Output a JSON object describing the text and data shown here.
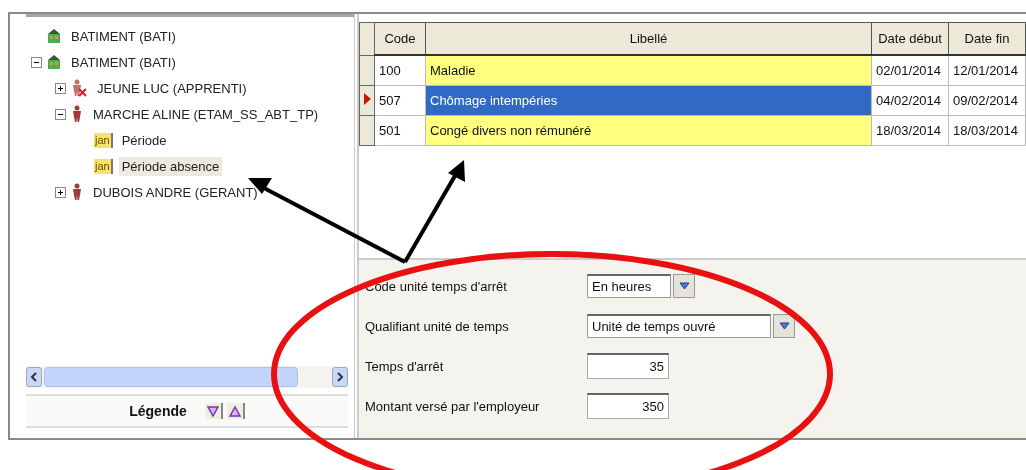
{
  "tree": [
    {
      "label": "BATIMENT (BATI)",
      "kind": "building",
      "selected": false
    },
    {
      "label": "BATIMENT (BATI)",
      "kind": "building",
      "selected": false,
      "expanded": true,
      "children": [
        {
          "label": "JEUNE LUC (APPRENTI)",
          "kind": "person_excluded",
          "selected": false,
          "expanded": false
        },
        {
          "label": "MARCHE ALINE (ETAM_SS_ABT_TP)",
          "kind": "person",
          "selected": false,
          "expanded": true,
          "children": [
            {
              "label": "Période",
              "kind": "calendar",
              "icon_label": "jan",
              "selected": false
            },
            {
              "label": "Période absence",
              "kind": "calendar",
              "icon_label": "jan",
              "selected": true
            }
          ]
        },
        {
          "label": "DUBOIS ANDRE (GERANT)",
          "kind": "person",
          "selected": false,
          "expanded": false
        }
      ]
    }
  ],
  "legend": {
    "label": "Légende"
  },
  "table": {
    "columns": [
      "Code",
      "Libellé",
      "Date début",
      "Date fin"
    ],
    "rows": [
      {
        "cells": [
          "100",
          "Maladie",
          "02/01/2014",
          "12/01/2014"
        ],
        "selected": false
      },
      {
        "cells": [
          "507",
          "Chômage intempéries",
          "04/02/2014",
          "09/02/2014"
        ],
        "selected": true
      },
      {
        "cells": [
          "501",
          "Congé divers non rémunéré",
          "18/03/2014",
          "18/03/2014"
        ],
        "selected": false
      }
    ]
  },
  "form": [
    {
      "label": "Code unité temps d'arrêt",
      "kind": "select",
      "value": "En heures"
    },
    {
      "label": "Qualifiant unité de temps",
      "kind": "select",
      "value": "Unité de temps ouvré"
    },
    {
      "label": "Temps d'arrêt",
      "kind": "number",
      "value": "35"
    },
    {
      "label": "Montant versé par l'employeur",
      "kind": "number",
      "value": "350"
    }
  ]
}
